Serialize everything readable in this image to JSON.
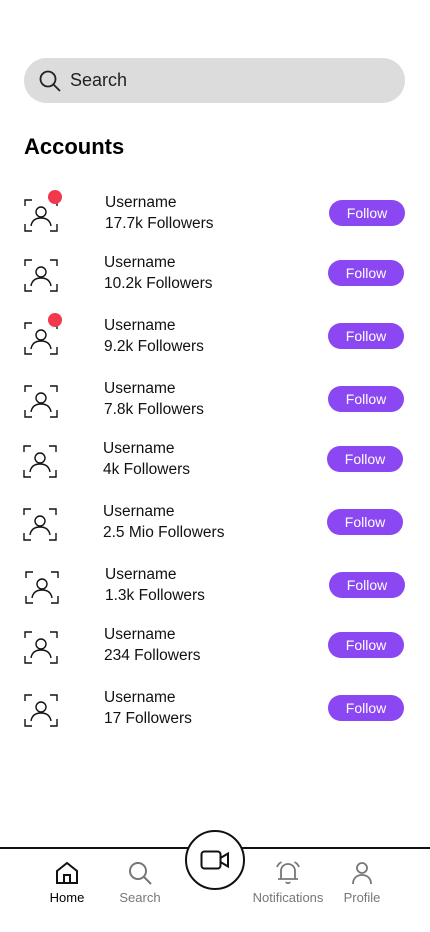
{
  "search": {
    "placeholder": "Search"
  },
  "section_title": "Accounts",
  "accounts": [
    {
      "name": "Username",
      "followers": "17.7k Followers",
      "button": "Follow",
      "notification_dot": true
    },
    {
      "name": "Username",
      "followers": "10.2k Followers",
      "button": "Follow",
      "notification_dot": false
    },
    {
      "name": "Username",
      "followers": "9.2k Followers",
      "button": "Follow",
      "notification_dot": true
    },
    {
      "name": "Username",
      "followers": "7.8k Followers",
      "button": "Follow",
      "notification_dot": false
    },
    {
      "name": "Username",
      "followers": "4k Followers",
      "button": "Follow",
      "notification_dot": false
    },
    {
      "name": "Username",
      "followers": "2.5 Mio Followers",
      "button": "Follow",
      "notification_dot": false
    },
    {
      "name": "Username",
      "followers": "1.3k Followers",
      "button": "Follow",
      "notification_dot": false
    },
    {
      "name": "Username",
      "followers": "234 Followers",
      "button": "Follow",
      "notification_dot": false
    },
    {
      "name": "Username",
      "followers": "17 Followers",
      "button": "Follow",
      "notification_dot": false
    }
  ],
  "nav": {
    "home": "Home",
    "search": "Search",
    "notifications": "Notifications",
    "profile": "Profile"
  },
  "colors": {
    "accent": "#8b47f2",
    "notification_dot": "#f2384d",
    "search_bg": "#dcdcdc"
  },
  "icons": [
    "search-icon",
    "account-avatar-icon",
    "home-icon",
    "camera-icon",
    "bell-icon",
    "profile-icon"
  ]
}
